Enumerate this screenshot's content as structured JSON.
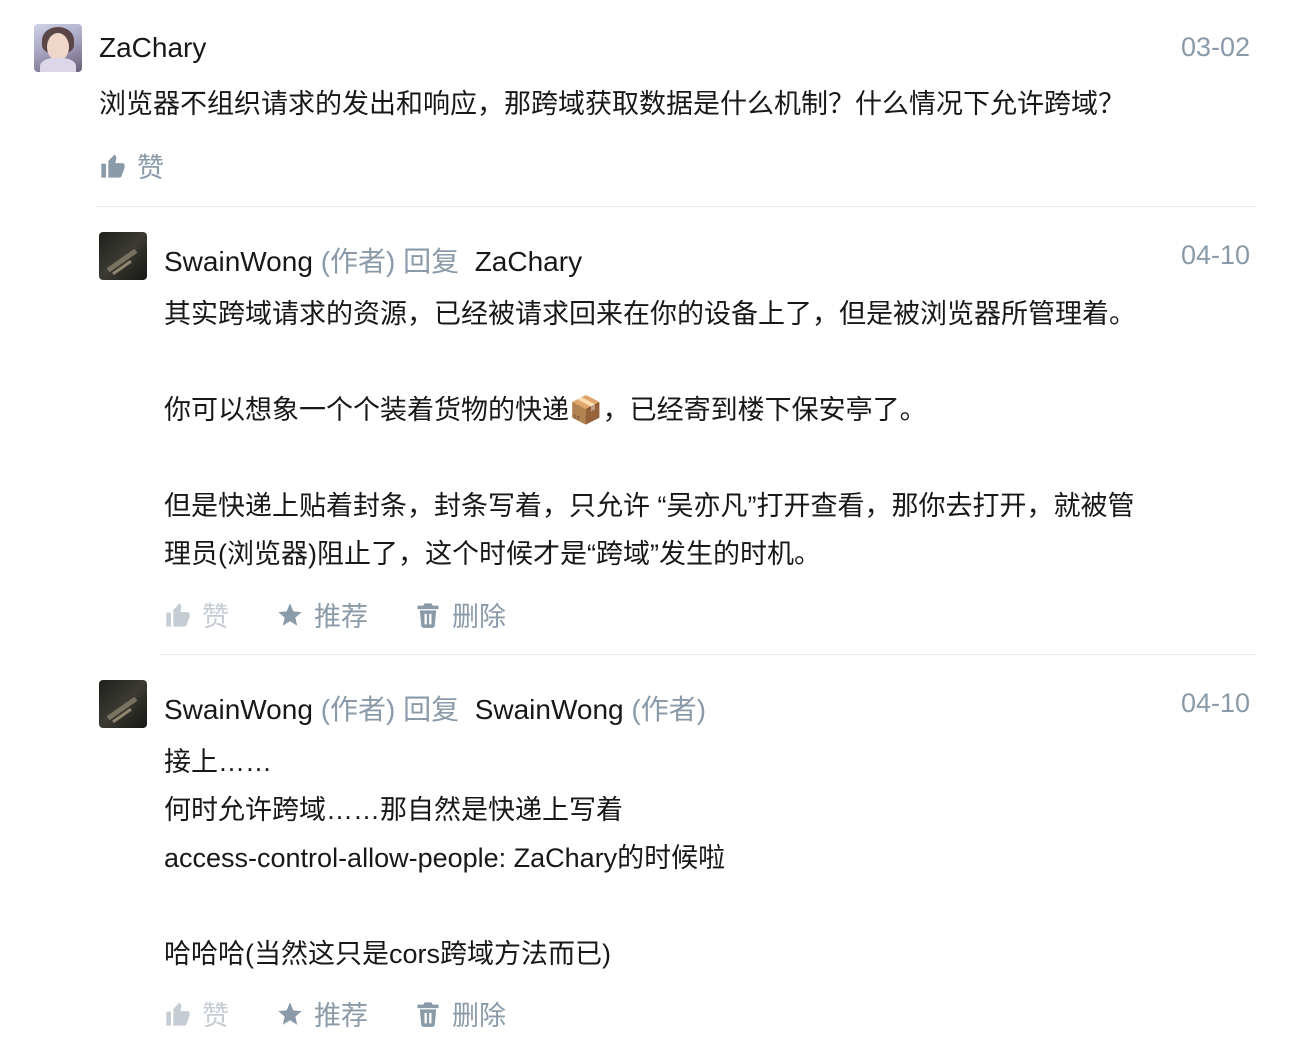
{
  "comment": {
    "username": "ZaChary",
    "date": "03-02",
    "text": "浏览器不组织请求的发出和响应，那跨域获取数据是什么机制？什么情况下允许跨域？",
    "like_label": "赞"
  },
  "replies": [
    {
      "username": "SwainWong",
      "author_tag": "(作者)",
      "reply_word": "回复",
      "reply_to": "ZaChary",
      "reply_to_tag": "",
      "date": "04-10",
      "lines": [
        "其实跨域请求的资源，已经被请求回来在你的设备上了，但是被浏览器所管理着。",
        "",
        "你可以想象一个个装着货物的快递📦，已经寄到楼下保安亭了。",
        "",
        "但是快递上贴着封条，封条写着，只允许 “吴亦凡”打开查看，那你去打开，就被管",
        "理员(浏览器)阻止了，这个时候才是“跨域”发生的时机。"
      ],
      "like_label": "赞",
      "recommend_label": "推荐",
      "delete_label": "删除"
    },
    {
      "username": "SwainWong",
      "author_tag": "(作者)",
      "reply_word": "回复",
      "reply_to": "SwainWong",
      "reply_to_tag": "(作者)",
      "date": "04-10",
      "lines": [
        "接上……",
        "何时允许跨域……那自然是快递上写着",
        "access-control-allow-people: ZaChary的时候啦",
        "",
        "哈哈哈(当然这只是cors跨域方法而已)"
      ],
      "like_label": "赞",
      "recommend_label": "推荐",
      "delete_label": "删除"
    }
  ]
}
